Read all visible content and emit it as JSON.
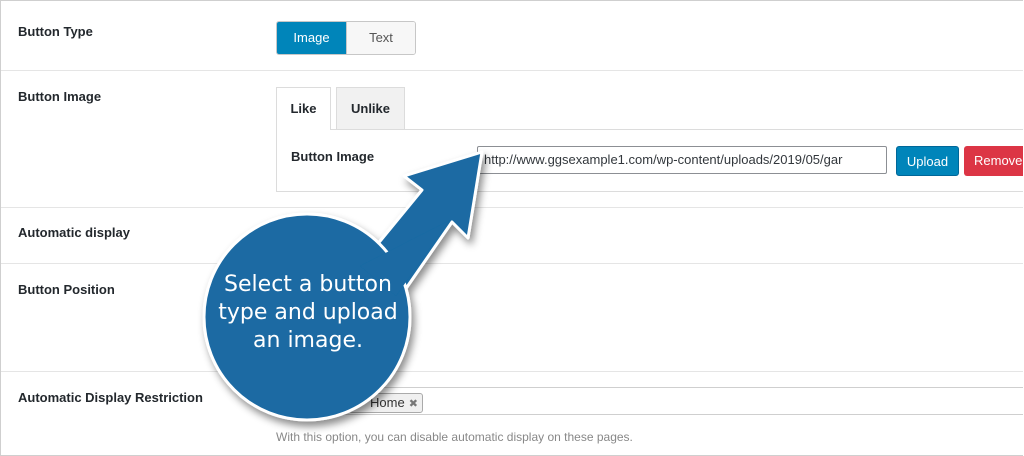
{
  "rows": {
    "button_type": {
      "label": "Button Type",
      "options": [
        {
          "label": "Image",
          "active": true
        },
        {
          "label": "Text",
          "active": false
        }
      ]
    },
    "button_image": {
      "label": "Button Image",
      "tabs": [
        {
          "label": "Like",
          "active": true
        },
        {
          "label": "Unlike",
          "active": false
        }
      ],
      "field_label": "Button Image",
      "url_value": "http://www.ggsexample1.com/wp-content/uploads/2019/05/gar",
      "upload_label": "Upload",
      "remove_label": "Remove"
    },
    "automatic_display": {
      "label": "Automatic display"
    },
    "button_position": {
      "label": "Button Position"
    },
    "automatic_display_restriction": {
      "label": "Automatic Display Restriction",
      "selected_tag": "Home",
      "help_text": "With this option, you can disable automatic display on these pages."
    }
  },
  "callout": {
    "text": "Select a button type and upload an image.",
    "line1": "Select a button",
    "line2": "type and upload",
    "line3": "an image.",
    "color": "#1a6aa3"
  },
  "colors": {
    "primary": "#0085ba",
    "danger": "#dc3545",
    "callout": "#1a6aa3"
  }
}
